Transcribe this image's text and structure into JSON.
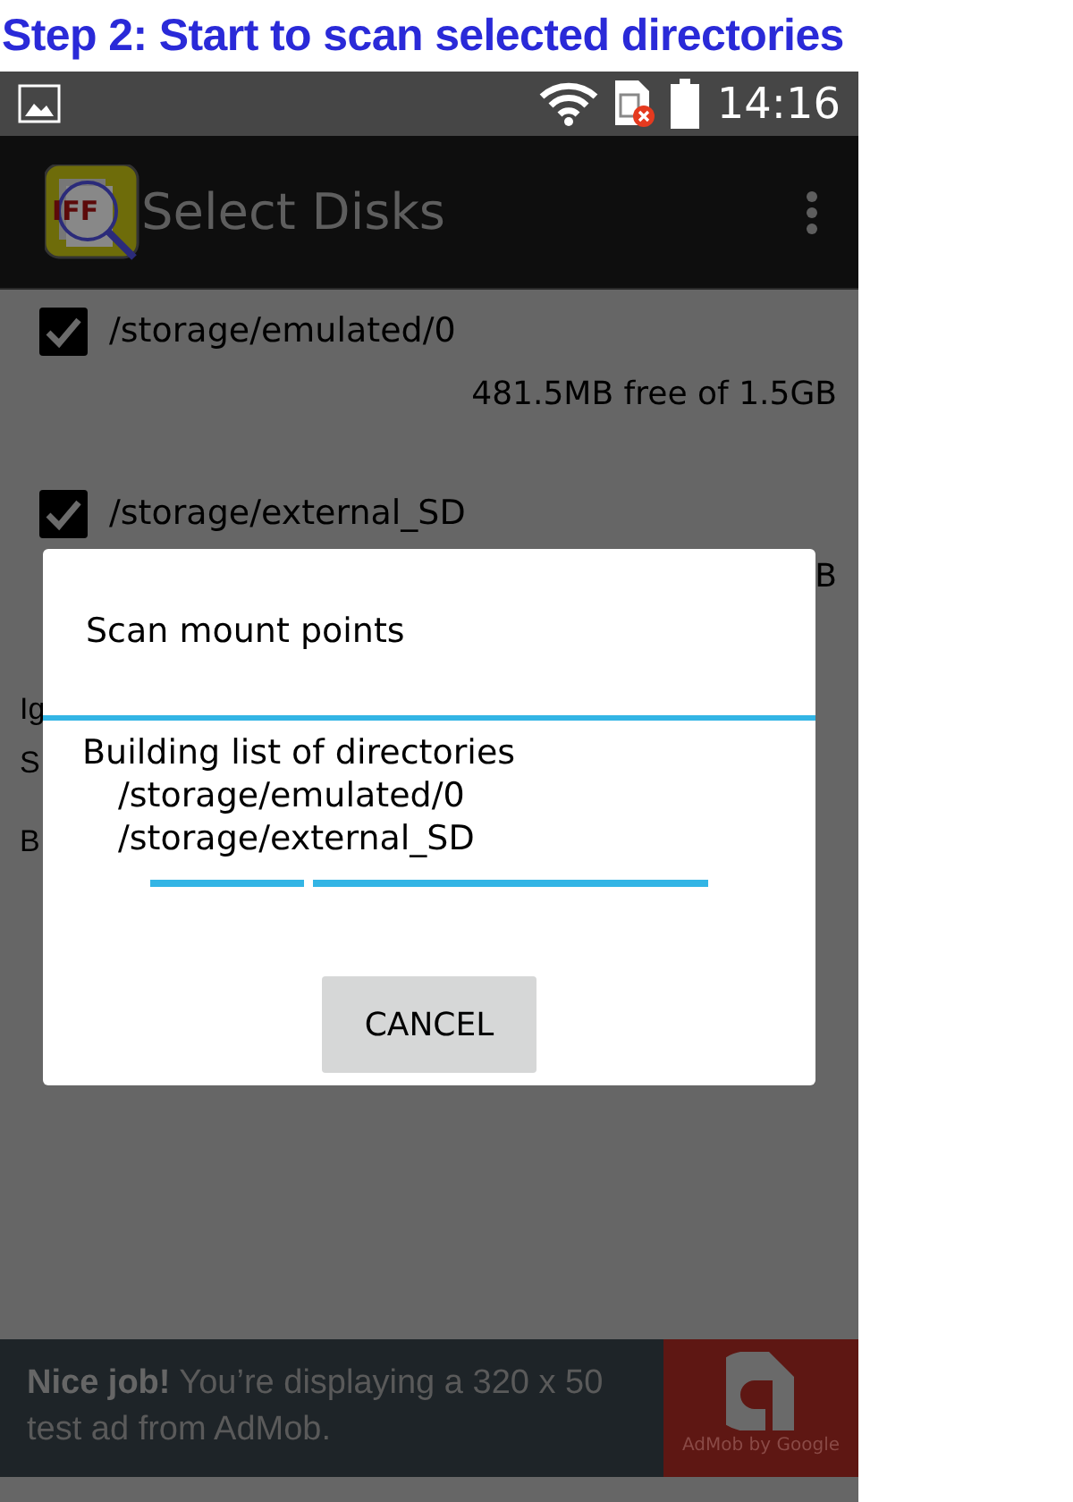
{
  "caption": "Step 2: Start to scan selected directories",
  "status_bar": {
    "time": "14:16"
  },
  "app_bar": {
    "logo_text": "IFF",
    "title": "Select Disks"
  },
  "disks": [
    {
      "path": "/storage/emulated/0",
      "checked": true,
      "free": "481.5MB free of 1.5GB"
    },
    {
      "path": "/storage/external_SD",
      "checked": true,
      "free": "B"
    }
  ],
  "background_labels": [
    "Ig",
    "S",
    "B"
  ],
  "dialog": {
    "title": "Scan mount points",
    "message": "Building list of directories",
    "directories": [
      "/storage/emulated/0",
      "/storage/external_SD"
    ],
    "button": "CANCEL"
  },
  "ad": {
    "text": "**Nice job!** You’re displaying a 320 x 50 test ad from AdMob.",
    "badge": "AdMob by Google"
  }
}
